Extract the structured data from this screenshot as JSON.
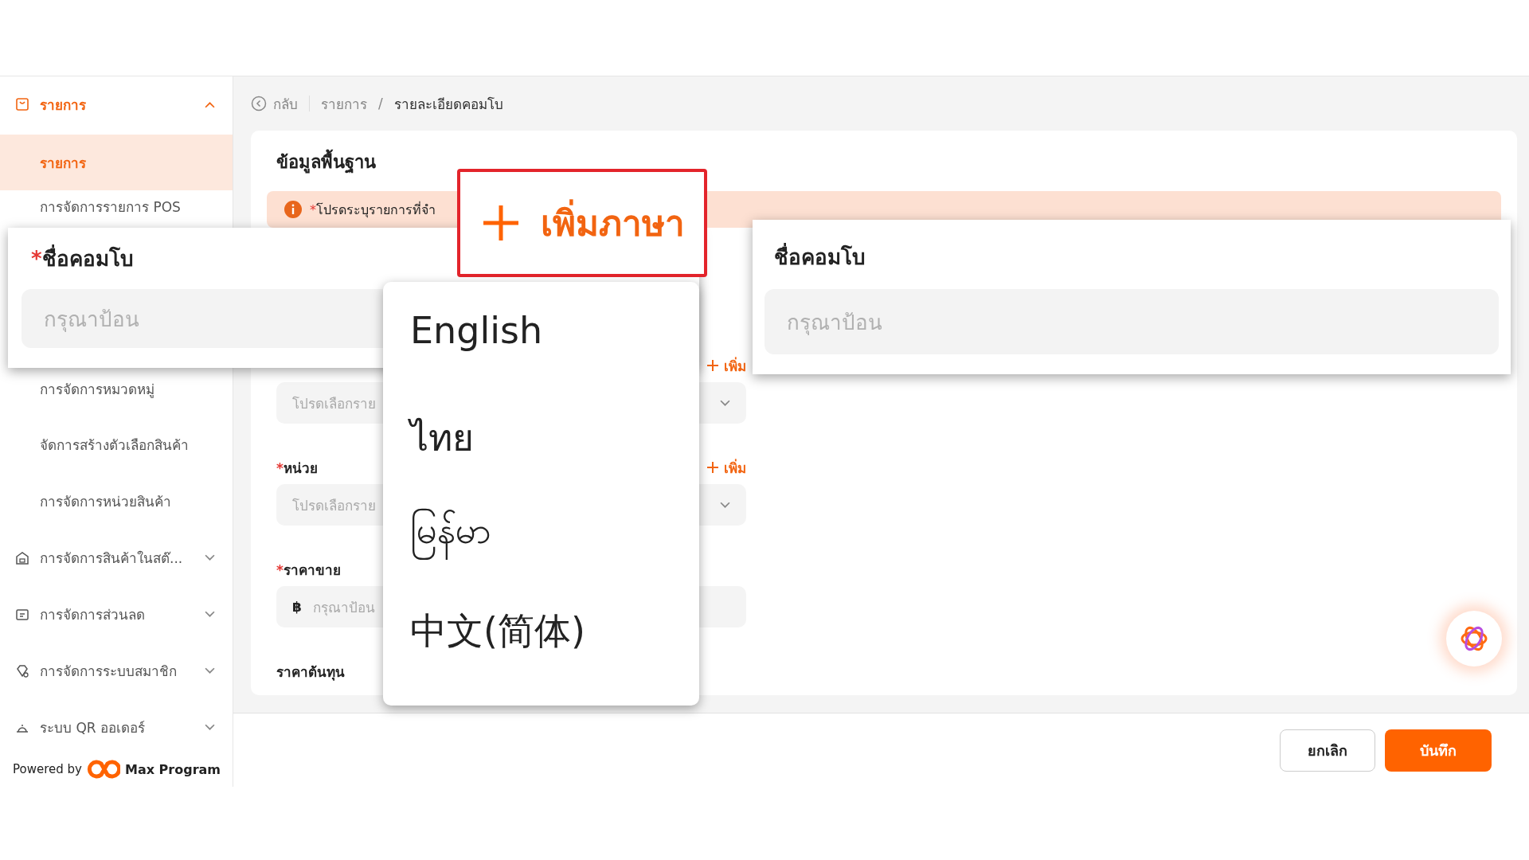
{
  "sidebar": {
    "items": [
      {
        "label": "รายการ",
        "expanded": true,
        "children": [
          {
            "label": "รายการ",
            "selected": true
          },
          {
            "label": "การจัดการรายการ POS",
            "selected": false
          },
          {
            "label": "การจัดการหมวดหมู่",
            "selected": false
          },
          {
            "label": "จัดการสร้างตัวเลือกสินค้า",
            "selected": false
          },
          {
            "label": "การจัดการหน่วยสินค้า",
            "selected": false
          }
        ]
      },
      {
        "label": "การจัดการสินค้าในสต๊...",
        "expanded": false
      },
      {
        "label": "การจัดการส่วนลด",
        "expanded": false
      },
      {
        "label": "การจัดการระบบสมาชิก",
        "expanded": false
      },
      {
        "label": "ระบบ QR ออเดอร์",
        "expanded": false
      }
    ],
    "powered_by": {
      "text": "Powered by",
      "brand": "Max Program"
    }
  },
  "breadcrumb": {
    "back": "กลับ",
    "separator": "/",
    "items": [
      "รายการ",
      "รายละเอียดคอมโบ"
    ]
  },
  "card": {
    "title": "ข้อมูลพื้นฐาน",
    "notice": {
      "asterisk": "*",
      "text": "โปรดระบุรายการที่จำ"
    },
    "fields": [
      {
        "kind": "select",
        "add": "เพิ่ม",
        "placeholder": "โปรดเลือกราย"
      },
      {
        "kind": "select",
        "asterisk": "*",
        "label": "หน่วย",
        "add": "เพิ่ม",
        "placeholder": "โปรดเลือกราย"
      },
      {
        "kind": "money",
        "asterisk": "*",
        "label": "ราคาขาย",
        "prefix": "฿",
        "placeholder": "กรุณาป้อน"
      },
      {
        "kind": "label",
        "label": "ราคาต้นทุน"
      }
    ]
  },
  "footer": {
    "buttons": [
      {
        "label": "ยกเลิก",
        "kind": "secondary"
      },
      {
        "label": "บันทึก",
        "kind": "primary"
      }
    ]
  },
  "callouts": {
    "left": {
      "asterisk": "*",
      "label": "ชื่อคอมโบ",
      "placeholder": "กรุณาป้อน"
    },
    "add_language": {
      "label": "เพิ่มภาษา"
    },
    "languages": [
      "English",
      "ไทย",
      "မြန်မာ",
      "中文(简体)"
    ],
    "right": {
      "label": "ชื่อคอมโบ",
      "placeholder": "กรุณาป้อน"
    }
  }
}
